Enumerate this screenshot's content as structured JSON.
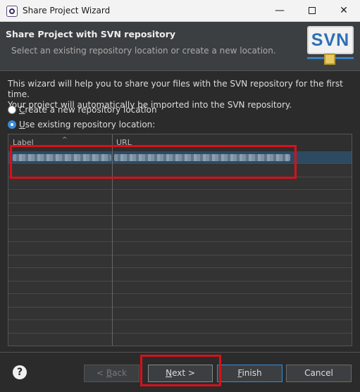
{
  "window": {
    "title": "Share Project Wizard",
    "minimize_glyph": "—",
    "close_glyph": "✕"
  },
  "header": {
    "title": "Share Project with SVN repository",
    "subtitle": "Select an existing repository location or create a new location.",
    "logo_text": "SVN"
  },
  "body": {
    "description_line1": "This wizard will help you to share your files with the SVN repository for the first time.",
    "description_line2": "Your project will automatically be imported into the SVN repository.",
    "option_create": {
      "prefix": "C",
      "rest": "reate a new repository location",
      "selected": false
    },
    "option_existing": {
      "prefix": "U",
      "rest": "se existing repository location:",
      "selected": true
    }
  },
  "table": {
    "columns": [
      "Label",
      "URL"
    ],
    "sort_indicator": "^",
    "rows_visible": 15
  },
  "footer": {
    "help_glyph": "?",
    "back": {
      "prefix": "< ",
      "underlined": "B",
      "rest": "ack"
    },
    "next": {
      "underlined": "N",
      "rest": "ext >"
    },
    "finish": {
      "underlined": "F",
      "rest": "inish"
    },
    "cancel": "Cancel"
  },
  "colors": {
    "highlight": "#d9101a",
    "accent": "#3b8ad9",
    "background": "#2b2b2b"
  }
}
